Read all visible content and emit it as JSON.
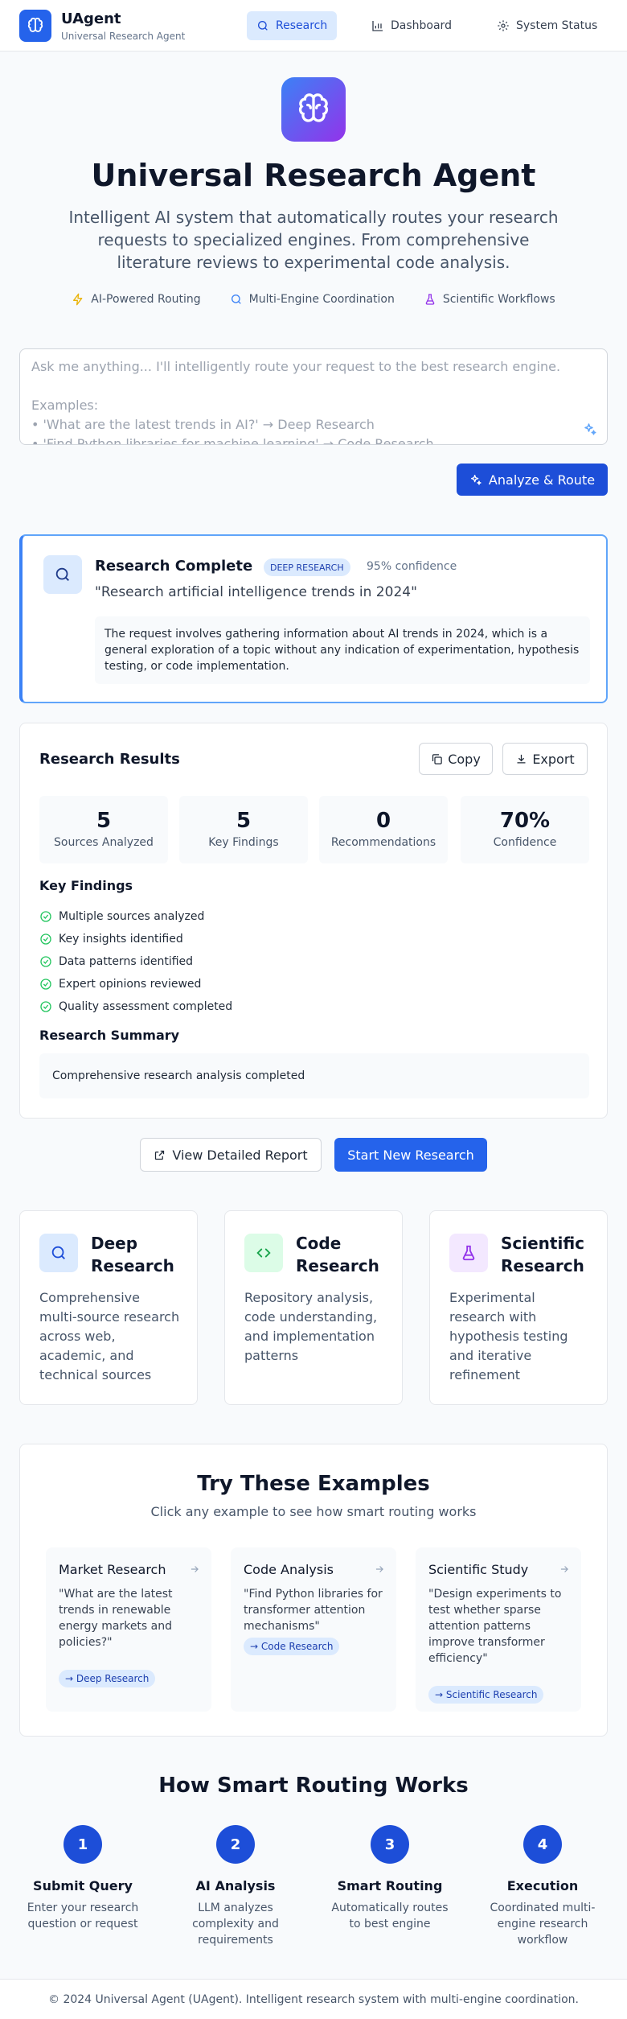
{
  "brand": {
    "name": "UAgent",
    "subtitle": "Universal Research Agent"
  },
  "nav": [
    {
      "label": "Research",
      "active": true
    },
    {
      "label": "Dashboard",
      "active": false
    },
    {
      "label": "System Status",
      "active": false
    }
  ],
  "hero": {
    "title": "Universal Research Agent",
    "description": "Intelligent AI system that automatically routes your research requests to specialized engines. From comprehensive literature reviews to experimental code analysis.",
    "features": [
      "AI-Powered Routing",
      "Multi-Engine Coordination",
      "Scientific Workflows"
    ]
  },
  "query": {
    "placeholder_lines": [
      "Ask me anything... I'll intelligently route your request to the best research engine.",
      "",
      "Examples:",
      "• 'What are the latest trends in AI?' → Deep Research",
      "• 'Find Python libraries for machine learning' → Code Research"
    ],
    "submit_label": "Analyze & Route"
  },
  "routing": {
    "title": "Research Complete",
    "badge": "DEEP RESEARCH",
    "confidence": "95% confidence",
    "query": "\"Research artificial intelligence trends in 2024\"",
    "reasoning": "The request involves gathering information about AI trends in 2024, which is a general exploration of a topic without any indication of experimentation, hypothesis testing, or code implementation."
  },
  "results": {
    "title": "Research Results",
    "copy_label": "Copy",
    "export_label": "Export",
    "stats": [
      {
        "value": "5",
        "label": "Sources Analyzed"
      },
      {
        "value": "5",
        "label": "Key Findings"
      },
      {
        "value": "0",
        "label": "Recommendations"
      },
      {
        "value": "70%",
        "label": "Confidence"
      }
    ],
    "key_findings_title": "Key Findings",
    "key_findings": [
      "Multiple sources analyzed",
      "Key insights identified",
      "Data patterns identified",
      "Expert opinions reviewed",
      "Quality assessment completed"
    ],
    "summary_title": "Research Summary",
    "summary": "Comprehensive research analysis completed"
  },
  "actions": {
    "detail_label": "View Detailed Report",
    "new_label": "Start New Research"
  },
  "engines": [
    {
      "title": "Deep Research",
      "description": "Comprehensive multi-source research across web, academic, and technical sources"
    },
    {
      "title": "Code Research",
      "description": "Repository analysis, code understanding, and implementation patterns"
    },
    {
      "title": "Scientific Research",
      "description": "Experimental research with hypothesis testing and iterative refinement"
    }
  ],
  "examples": {
    "title": "Try These Examples",
    "subtitle": "Click any example to see how smart routing works",
    "items": [
      {
        "name": "Market Research",
        "query": "\"What are the latest trends in renewable energy markets and policies?\"",
        "tag": "→ Deep Research"
      },
      {
        "name": "Code Analysis",
        "query": "\"Find Python libraries for transformer attention mechanisms\"",
        "tag": "→ Code Research"
      },
      {
        "name": "Scientific Study",
        "query": "\"Design experiments to test whether sparse attention patterns improve transformer efficiency\"",
        "tag": "→ Scientific Research"
      }
    ]
  },
  "how": {
    "title": "How Smart Routing Works",
    "steps": [
      {
        "num": "1",
        "title": "Submit Query",
        "desc": "Enter your research question or request"
      },
      {
        "num": "2",
        "title": "AI Analysis",
        "desc": "LLM analyzes complexity and requirements"
      },
      {
        "num": "3",
        "title": "Smart Routing",
        "desc": "Automatically routes to best engine"
      },
      {
        "num": "4",
        "title": "Execution",
        "desc": "Coordinated multi-engine research workflow"
      }
    ]
  },
  "footer": "© 2024 Universal Agent (UAgent). Intelligent research system with multi-engine coordination.",
  "colors": {
    "primary": "#2563eb",
    "primary_dark": "#1d4ed8",
    "success": "#22c55e",
    "gradient_start": "#3b82f6",
    "gradient_end": "#9333ea"
  }
}
